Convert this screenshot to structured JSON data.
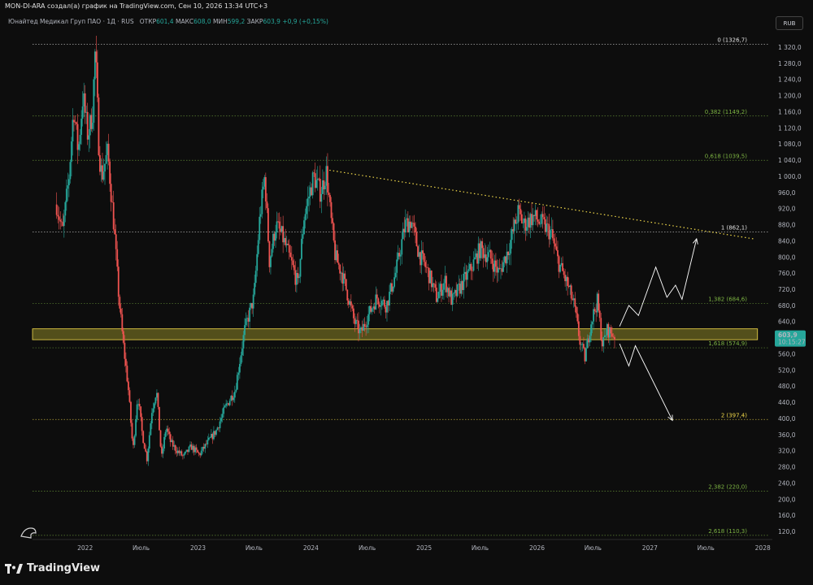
{
  "header": {
    "attribution": "MON-DI-ARA создал(а) график на TradingView.com, Сен 10, 2026 13:34 UTC+3"
  },
  "symbol": {
    "name": "Юнайтед Медикал Груп ПАО · 1Д · RUS",
    "open_label": "ОТКР",
    "open_value": "601,4",
    "high_label": "МАКС",
    "high_value": "608,0",
    "low_label": "МИН",
    "low_value": "599,2",
    "close_label": "ЗАКР",
    "close_value": "603,9",
    "change": "+0,9 (+0,15%)"
  },
  "currency_button": "RUB",
  "brand": "TradingView",
  "colors": {
    "up": "#26a69a",
    "down": "#ef5350",
    "fib_green": "#7cb342",
    "fib_yellow": "#f0d84a",
    "zone_fill": "#6b6520",
    "price_tag": "#26a69a"
  },
  "chart_data": {
    "type": "candlestick",
    "price_scale": "RUB",
    "ylim": [
      100,
      1340
    ],
    "xlim": [
      "2021-07-15",
      "2028-02-01"
    ],
    "y_ticks": [
      "1 320,0",
      "1 280,0",
      "1 240,0",
      "1 200,0",
      "1 160,0",
      "1 120,0",
      "1 080,0",
      "1 040,0",
      "1 000,0",
      "960,0",
      "920,0",
      "880,0",
      "840,0",
      "800,0",
      "760,0",
      "720,0",
      "680,0",
      "640,0",
      "600,0",
      "560,0",
      "520,0",
      "480,0",
      "440,0",
      "400,0",
      "360,0",
      "320,0",
      "280,0",
      "240,0",
      "200,0",
      "160,0",
      "120,0"
    ],
    "y_tick_values": [
      1320,
      1280,
      1240,
      1200,
      1160,
      1120,
      1080,
      1040,
      1000,
      960,
      920,
      880,
      840,
      800,
      760,
      720,
      680,
      640,
      600,
      560,
      520,
      480,
      440,
      400,
      360,
      320,
      280,
      240,
      200,
      160,
      120
    ],
    "x_ticks": [
      {
        "label": "2022",
        "date": "2022-01-01"
      },
      {
        "label": "Июль",
        "date": "2022-07-01"
      },
      {
        "label": "2023",
        "date": "2023-01-01"
      },
      {
        "label": "Июль",
        "date": "2023-07-01"
      },
      {
        "label": "2024",
        "date": "2024-01-01"
      },
      {
        "label": "Июль",
        "date": "2024-07-01"
      },
      {
        "label": "2025",
        "date": "2025-01-01"
      },
      {
        "label": "Июль",
        "date": "2025-07-01"
      },
      {
        "label": "2026",
        "date": "2026-01-01"
      },
      {
        "label": "Июль",
        "date": "2026-07-01"
      },
      {
        "label": "2027",
        "date": "2027-01-01"
      },
      {
        "label": "Июль",
        "date": "2027-07-01"
      },
      {
        "label": "2028",
        "date": "2028-01-01"
      }
    ],
    "price_path": [
      [
        "2021-10-01",
        930
      ],
      [
        "2021-10-20",
        860
      ],
      [
        "2021-11-10",
        1000
      ],
      [
        "2021-11-25",
        1170
      ],
      [
        "2021-12-10",
        1060
      ],
      [
        "2021-12-25",
        1200
      ],
      [
        "2022-01-10",
        1100
      ],
      [
        "2022-01-25",
        1160
      ],
      [
        "2022-02-03",
        1320
      ],
      [
        "2022-02-15",
        1060
      ],
      [
        "2022-02-24",
        1000
      ],
      [
        "2022-03-15",
        1060
      ],
      [
        "2022-04-05",
        870
      ],
      [
        "2022-04-20",
        700
      ],
      [
        "2022-05-05",
        580
      ],
      [
        "2022-05-20",
        480
      ],
      [
        "2022-06-05",
        320
      ],
      [
        "2022-06-20",
        460
      ],
      [
        "2022-07-05",
        360
      ],
      [
        "2022-07-20",
        300
      ],
      [
        "2022-08-05",
        420
      ],
      [
        "2022-08-20",
        470
      ],
      [
        "2022-09-05",
        300
      ],
      [
        "2022-09-20",
        380
      ],
      [
        "2022-10-05",
        340
      ],
      [
        "2022-10-25",
        320
      ],
      [
        "2022-11-15",
        305
      ],
      [
        "2022-12-10",
        330
      ],
      [
        "2023-01-05",
        310
      ],
      [
        "2023-02-01",
        340
      ],
      [
        "2023-03-01",
        370
      ],
      [
        "2023-04-01",
        430
      ],
      [
        "2023-05-01",
        470
      ],
      [
        "2023-06-01",
        620
      ],
      [
        "2023-07-01",
        700
      ],
      [
        "2023-07-20",
        900
      ],
      [
        "2023-08-05",
        1000
      ],
      [
        "2023-08-20",
        790
      ],
      [
        "2023-09-10",
        880
      ],
      [
        "2023-10-01",
        850
      ],
      [
        "2023-11-01",
        780
      ],
      [
        "2023-11-20",
        730
      ],
      [
        "2023-12-10",
        900
      ],
      [
        "2024-01-10",
        1000
      ],
      [
        "2024-02-01",
        960
      ],
      [
        "2024-02-20",
        1010
      ],
      [
        "2024-03-05",
        900
      ],
      [
        "2024-03-20",
        800
      ],
      [
        "2024-04-10",
        760
      ],
      [
        "2024-05-01",
        700
      ],
      [
        "2024-05-20",
        640
      ],
      [
        "2024-06-10",
        610
      ],
      [
        "2024-07-01",
        650
      ],
      [
        "2024-08-01",
        700
      ],
      [
        "2024-09-01",
        680
      ],
      [
        "2024-10-01",
        760
      ],
      [
        "2024-11-01",
        880
      ],
      [
        "2024-11-20",
        890
      ],
      [
        "2024-12-15",
        810
      ],
      [
        "2025-01-15",
        760
      ],
      [
        "2025-02-10",
        700
      ],
      [
        "2025-03-10",
        740
      ],
      [
        "2025-04-01",
        690
      ],
      [
        "2025-05-01",
        730
      ],
      [
        "2025-06-01",
        770
      ],
      [
        "2025-07-01",
        820
      ],
      [
        "2025-08-01",
        800
      ],
      [
        "2025-09-01",
        760
      ],
      [
        "2025-10-01",
        820
      ],
      [
        "2025-11-01",
        910
      ],
      [
        "2025-11-20",
        880
      ],
      [
        "2025-12-20",
        900
      ],
      [
        "2026-01-20",
        880
      ],
      [
        "2026-02-15",
        860
      ],
      [
        "2026-03-10",
        790
      ],
      [
        "2026-04-10",
        730
      ],
      [
        "2026-05-01",
        680
      ],
      [
        "2026-05-20",
        590
      ],
      [
        "2026-06-05",
        550
      ],
      [
        "2026-06-25",
        640
      ],
      [
        "2026-07-15",
        690
      ],
      [
        "2026-08-01",
        580
      ],
      [
        "2026-08-15",
        620
      ],
      [
        "2026-09-10",
        603.9
      ]
    ],
    "last_price": {
      "value": "603,9",
      "timer": "10:15:27"
    },
    "fib_levels": [
      {
        "ratio": "0",
        "value": 1326.7,
        "label": "0 (1326,7)",
        "color": "#e0e0e0"
      },
      {
        "ratio": "0.382",
        "value": 1149.2,
        "label": "0,382 (1149,2)",
        "color": "#7cb342"
      },
      {
        "ratio": "0.618",
        "value": 1039.5,
        "label": "0,618 (1039,5)",
        "color": "#7cb342"
      },
      {
        "ratio": "1",
        "value": 862.1,
        "label": "1 (862,1)",
        "color": "#e0e0e0"
      },
      {
        "ratio": "1.382",
        "value": 684.6,
        "label": "1,382 (684,6)",
        "color": "#7cb342"
      },
      {
        "ratio": "1.618",
        "value": 574.9,
        "label": "1,618 (574,9)",
        "color": "#7cb342"
      },
      {
        "ratio": "2",
        "value": 397.4,
        "label": "2 (397,4)",
        "color": "#f0d84a"
      },
      {
        "ratio": "2.382",
        "value": 220.0,
        "label": "2,382 (220,0)",
        "color": "#7cb342"
      },
      {
        "ratio": "2.618",
        "value": 110.3,
        "label": "2,618 (110,3)",
        "color": "#7cb342"
      }
    ],
    "support_zone": {
      "from": "2021-07-15",
      "to": "2027-12-15",
      "low": 595,
      "high": 622
    },
    "trendline": {
      "from": [
        "2024-03-01",
        1015
      ],
      "to": [
        "2027-12-01",
        845
      ]
    },
    "projection_up": [
      [
        "2026-09-25",
        628
      ],
      [
        "2026-10-25",
        680
      ],
      [
        "2026-11-25",
        655
      ],
      [
        "2027-01-20",
        775
      ],
      [
        "2027-02-25",
        700
      ],
      [
        "2027-03-25",
        730
      ],
      [
        "2027-04-15",
        695
      ],
      [
        "2027-06-01",
        845
      ]
    ],
    "projection_down": [
      [
        "2026-09-25",
        585
      ],
      [
        "2026-10-25",
        530
      ],
      [
        "2026-11-15",
        580
      ],
      [
        "2027-03-15",
        395
      ]
    ]
  }
}
